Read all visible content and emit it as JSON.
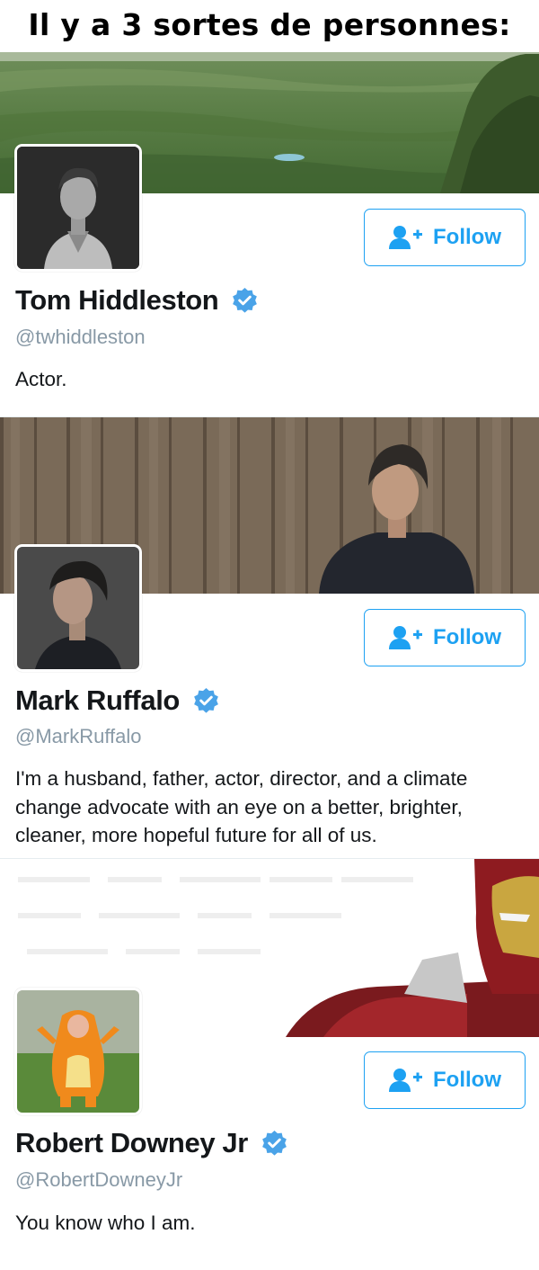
{
  "meme_title": "Il y a 3 sortes de personnes:",
  "profiles": [
    {
      "name": "Tom Hiddleston",
      "handle": "@twhiddleston",
      "bio": "Actor.",
      "follow_label": "Follow",
      "verified": true
    },
    {
      "name": "Mark Ruffalo",
      "handle": "@MarkRuffalo",
      "bio": "I'm a husband, father, actor, director, and a climate change advocate with an eye on a better, brighter, cleaner, more hopeful future for all of us.",
      "follow_label": "Follow",
      "verified": true
    },
    {
      "name": "Robert Downey Jr",
      "handle": "@RobertDowneyJr",
      "bio": "You know who I am.",
      "follow_label": "Follow",
      "verified": true
    }
  ],
  "colors": {
    "accent": "#1da1f2",
    "verified_badge": "#4aa3e8",
    "name_text": "#14171a",
    "handle_text": "#8899a6"
  },
  "icons": {
    "follow": "add-user-icon",
    "verified": "verified-badge-icon"
  }
}
